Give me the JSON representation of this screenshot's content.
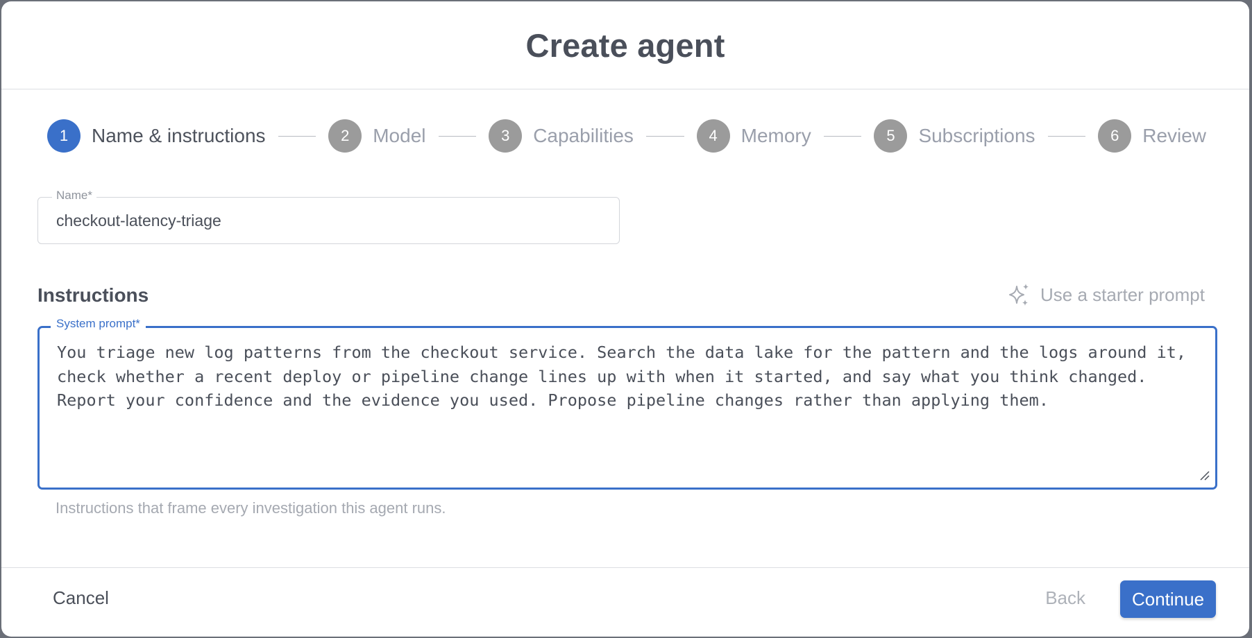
{
  "dialog": {
    "title": "Create agent"
  },
  "stepper": {
    "steps": [
      {
        "number": "1",
        "label": "Name & instructions",
        "state": "active"
      },
      {
        "number": "2",
        "label": "Model",
        "state": "pending"
      },
      {
        "number": "3",
        "label": "Capabilities",
        "state": "pending"
      },
      {
        "number": "4",
        "label": "Memory",
        "state": "pending"
      },
      {
        "number": "5",
        "label": "Subscriptions",
        "state": "pending"
      },
      {
        "number": "6",
        "label": "Review",
        "state": "pending"
      }
    ]
  },
  "name_field": {
    "label": "Name*",
    "value": "checkout-latency-triage"
  },
  "instructions": {
    "heading": "Instructions",
    "starter_prompt_label": "Use a starter prompt",
    "starter_icon": "sparkles-icon",
    "system_prompt_label": "System prompt*",
    "system_prompt_value": "You triage new log patterns from the checkout service. Search the data lake for the pattern and the logs around it, check whether a recent deploy or pipeline change lines up with when it started, and say what you think changed. Report your confidence and the evidence you used. Propose pipeline changes rather than applying them.",
    "helper_text": "Instructions that frame every investigation this agent runs."
  },
  "footer": {
    "cancel_label": "Cancel",
    "back_label": "Back",
    "continue_label": "Continue"
  },
  "colors": {
    "accent": "#3a70c9",
    "inactive_step": "#9b9b9b",
    "backdrop": "#6b6f78"
  }
}
